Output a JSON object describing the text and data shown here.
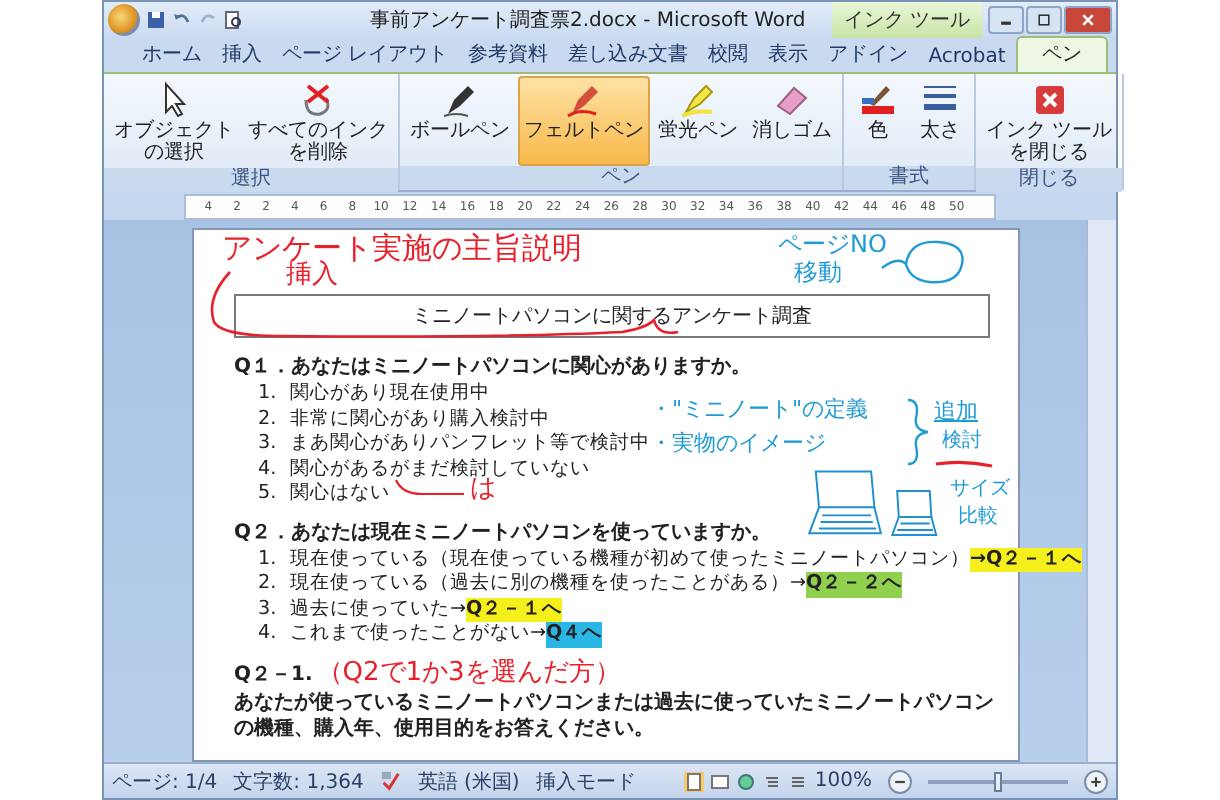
{
  "window": {
    "title": "事前アンケート調査票2.docx - Microsoft Word",
    "context_tab": "インク ツール"
  },
  "tabs": [
    {
      "label": "ホーム",
      "selected": false
    },
    {
      "label": "挿入",
      "selected": false
    },
    {
      "label": "ページ レイアウト",
      "selected": false
    },
    {
      "label": "参考資料",
      "selected": false
    },
    {
      "label": "差し込み文書",
      "selected": false
    },
    {
      "label": "校閲",
      "selected": false
    },
    {
      "label": "表示",
      "selected": false
    },
    {
      "label": "アドイン",
      "selected": false
    },
    {
      "label": "Acrobat",
      "selected": false
    },
    {
      "label": "ペン",
      "selected": true
    }
  ],
  "ribbon_groups": [
    {
      "label": "選択",
      "buttons": [
        {
          "lines": [
            "オブジェクト",
            "の選択"
          ],
          "kind": "cursor",
          "selected": false
        },
        {
          "lines": [
            "すべてのインク",
            "を削除"
          ],
          "kind": "erase-all",
          "selected": false
        }
      ]
    },
    {
      "label": "ペン",
      "buttons": [
        {
          "lines": [
            "ボールペン"
          ],
          "kind": "pen",
          "selected": false
        },
        {
          "lines": [
            "フェルトペン"
          ],
          "kind": "felt",
          "selected": true
        },
        {
          "lines": [
            "蛍光ペン"
          ],
          "kind": "highlighter",
          "selected": false
        },
        {
          "lines": [
            "消しゴム"
          ],
          "kind": "eraser",
          "selected": false
        }
      ]
    },
    {
      "label": "書式",
      "buttons": [
        {
          "lines": [
            "色"
          ],
          "kind": "color",
          "selected": false
        },
        {
          "lines": [
            "太さ"
          ],
          "kind": "weight",
          "selected": false
        }
      ]
    },
    {
      "label": "閉じる",
      "buttons": [
        {
          "lines": [
            "インク ツール",
            "を閉じる"
          ],
          "kind": "close",
          "selected": false
        }
      ]
    }
  ],
  "ruler": [
    "4",
    "2",
    "2",
    "4",
    "6",
    "8",
    "10",
    "12",
    "14",
    "16",
    "18",
    "20",
    "22",
    "24",
    "26",
    "28",
    "30",
    "32",
    "34",
    "36",
    "38",
    "40",
    "42",
    "44",
    "46",
    "48",
    "50"
  ],
  "document": {
    "title": "ミニノートパソコンに関するアンケート調査",
    "q1": {
      "heading": "Q１．あなたはミニノートパソコンに関心がありますか。",
      "items": [
        {
          "num": "1.",
          "text": "関心があり現在使用中"
        },
        {
          "num": "2.",
          "text": "非常に関心があり購入検討中"
        },
        {
          "num": "3.",
          "text": "まあ関心がありパンフレット等で検討中"
        },
        {
          "num": "4.",
          "text": "関心があるがまだ検討していない"
        },
        {
          "num": "5.",
          "text": "関心はない"
        }
      ]
    },
    "q2": {
      "heading": "Q２．あなたは現在ミニノートパソコンを使っていますか。",
      "items": [
        {
          "num": "1.",
          "text": "現在使っている（現在使っている機種が初めて使ったミニノートパソコン）",
          "jump": "→Q２－１へ",
          "color": "#f5f01c"
        },
        {
          "num": "2.",
          "text": "現在使っている（過去に別の機種を使ったことがある）→",
          "jump": "Q２－２へ",
          "color": "#8fd14f"
        },
        {
          "num": "3.",
          "text": "過去に使っていた→",
          "jump": "Q２－１へ",
          "color": "#f5f01c"
        },
        {
          "num": "4.",
          "text": "これまで使ったことがない→",
          "jump": "Q４へ",
          "color": "#2bb6e8"
        }
      ]
    },
    "q2_1": {
      "heading": "Q２－1.",
      "ink_note": "（Q2で1か3を選んだ方）",
      "text": "あなたが使っているミニノートパソコンまたは過去に使っていたミニノートパソコンの機種、購入年、使用目的をお答えください。"
    }
  },
  "ink_notes": [
    {
      "text": "アンケート実施の主旨説明",
      "color": "#e8202a"
    },
    {
      "text": "挿入",
      "color": "#e8202a"
    },
    {
      "text": "ページNO",
      "color": "#1e9ad6"
    },
    {
      "text": "移動",
      "color": "#1e9ad6"
    },
    {
      "text": "・\"ミニノート\"の定義",
      "color": "#1e9ad6"
    },
    {
      "text": "・実物のイメージ",
      "color": "#1e9ad6"
    },
    {
      "text": "追加",
      "color": "#1e9ad6"
    },
    {
      "text": "検討",
      "color": "#1e9ad6"
    },
    {
      "text": "サイズ",
      "color": "#1e9ad6"
    },
    {
      "text": "比較",
      "color": "#1e9ad6"
    },
    {
      "text": "は",
      "color": "#e8202a"
    }
  ],
  "status_bar": {
    "page": "ページ: 1/4",
    "words": "文字数: 1,364",
    "language": "英語 (米国)",
    "mode": "挿入モード",
    "zoom": "100%",
    "zoom_level": {
      "level": 0.5
    }
  }
}
